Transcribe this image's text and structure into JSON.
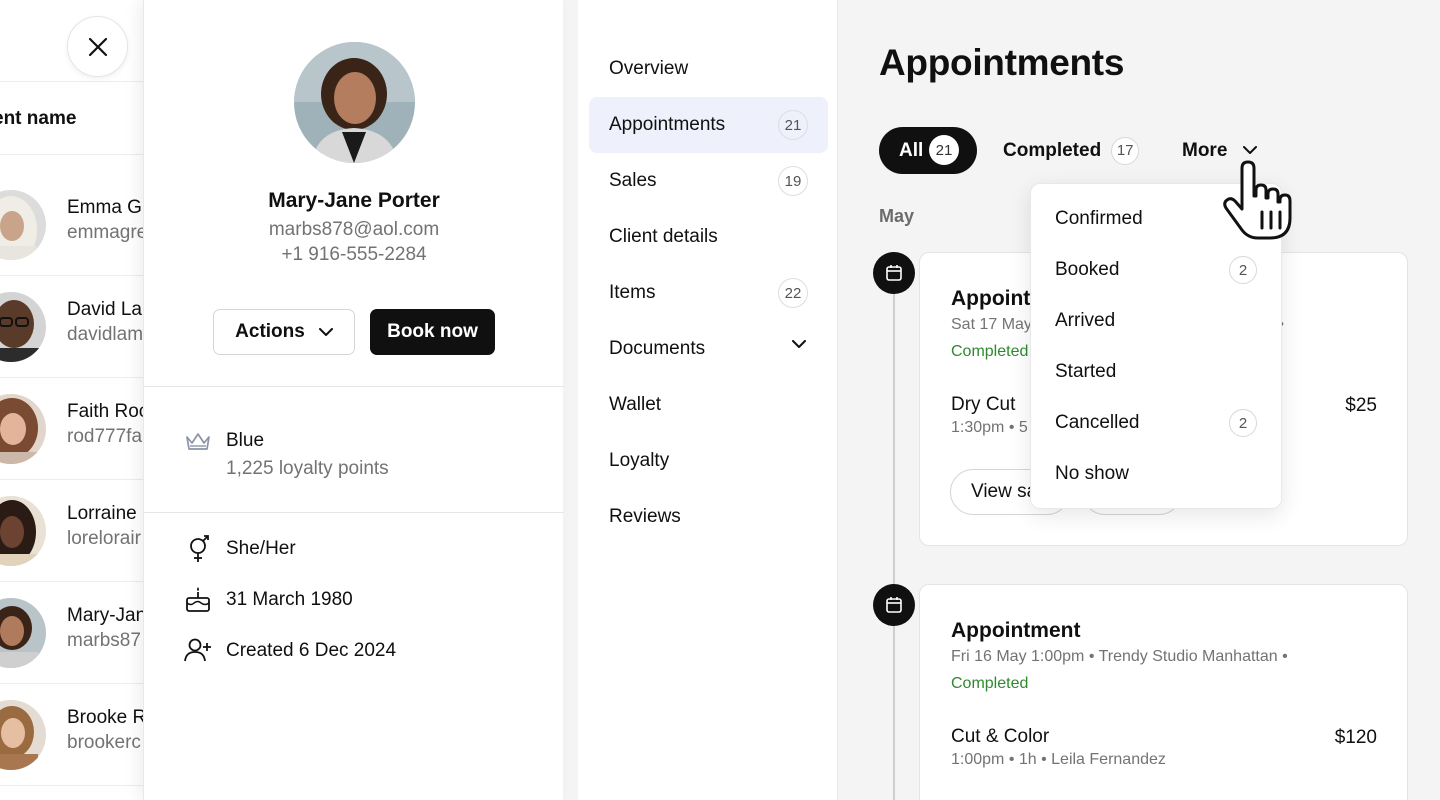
{
  "client_list": {
    "header": "ent name",
    "rows": [
      {
        "name": "Emma Gr",
        "email": "emmagre",
        "avatar": "woman-hijab-avatar"
      },
      {
        "name": "David Lar",
        "email": "davidlam",
        "avatar": "man-glasses-avatar"
      },
      {
        "name": "Faith Roc",
        "email": "rod777fa",
        "avatar": "woman-curly-avatar"
      },
      {
        "name": "Lorraine",
        "email": "lorelorair",
        "avatar": "woman-braids-avatar"
      },
      {
        "name": "Mary-Jan",
        "email": "marbs87",
        "avatar": "mary-jane-avatar"
      },
      {
        "name": "Brooke R",
        "email": "brookerc",
        "avatar": "woman-scarf-avatar"
      }
    ]
  },
  "profile": {
    "name": "Mary-Jane Porter",
    "email": "marbs878@aol.com",
    "phone": "+1 916-555-2284",
    "actions_label": "Actions",
    "book_label": "Book now",
    "loyalty_tier": "Blue",
    "loyalty_points": "1,225 loyalty points",
    "pronouns": "She/Her",
    "birthday": "31 March 1980",
    "created": "Created 6 Dec 2024"
  },
  "nav": {
    "items": [
      {
        "label": "Overview"
      },
      {
        "label": "Appointments",
        "count": "21",
        "active": true
      },
      {
        "label": "Sales",
        "count": "19"
      },
      {
        "label": "Client details"
      },
      {
        "label": "Items",
        "count": "22"
      },
      {
        "label": "Documents",
        "has_chevron": true
      },
      {
        "label": "Wallet"
      },
      {
        "label": "Loyalty"
      },
      {
        "label": "Reviews"
      }
    ]
  },
  "main": {
    "title": "Appointments",
    "filters": {
      "all_label": "All",
      "all_count": "21",
      "completed_label": "Completed",
      "completed_count": "17",
      "more_label": "More"
    },
    "month": "May",
    "appointments": [
      {
        "title": "Appoint",
        "meta_left": "Sat 17 May",
        "meta_right": "n  •",
        "status": "Completed",
        "service": "Dry Cut",
        "service_meta": "1:30pm  •  5",
        "price": "$25",
        "btn_view": "View sa"
      },
      {
        "title": "Appointment",
        "meta": "Fri 16 May 1:00pm  •  Trendy Studio Manhattan  •",
        "status": "Completed",
        "service": "Cut & Color",
        "service_meta": "1:00pm  •  1h  •  Leila Fernandez",
        "price": "$120"
      }
    ]
  },
  "dropdown": {
    "items": [
      {
        "label": "Confirmed"
      },
      {
        "label": "Booked",
        "count": "2"
      },
      {
        "label": "Arrived"
      },
      {
        "label": "Started"
      },
      {
        "label": "Cancelled",
        "count": "2"
      },
      {
        "label": "No show"
      }
    ]
  },
  "colors": {
    "accent_dark": "#101010",
    "status_completed": "#2f8a2f",
    "nav_active_bg": "#eef0fb",
    "background": "#f4f4f4"
  }
}
